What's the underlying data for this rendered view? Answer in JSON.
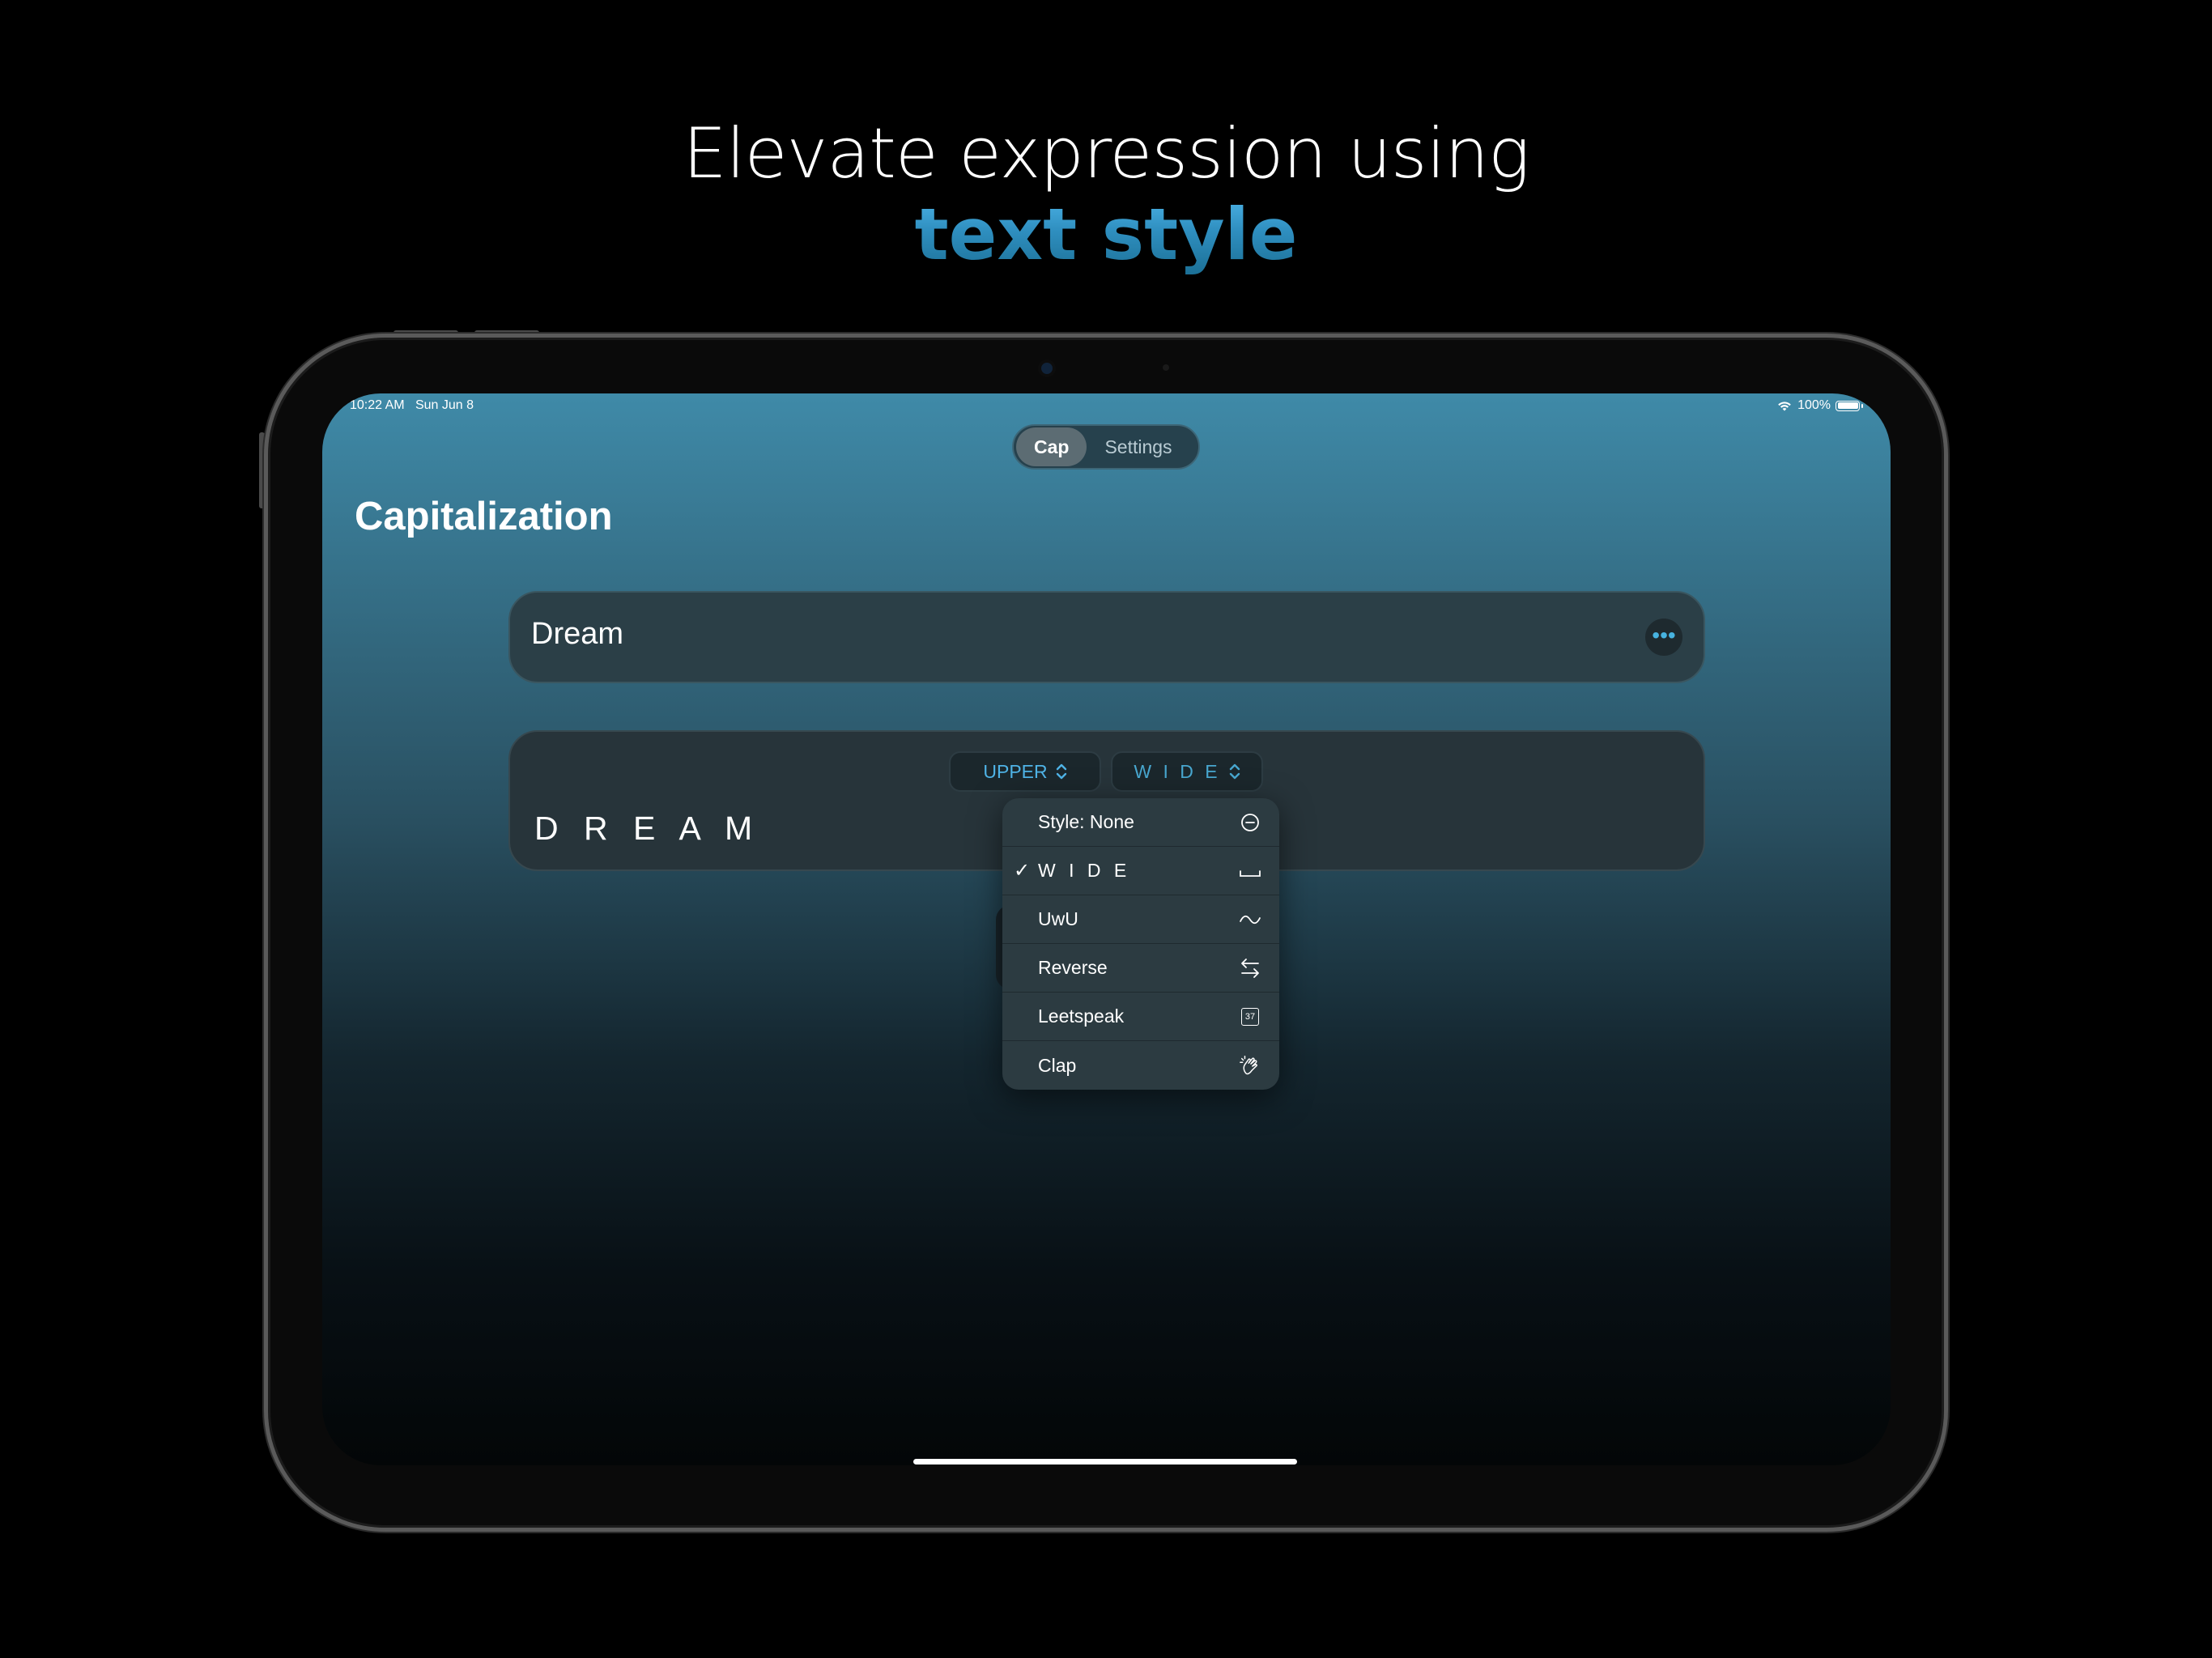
{
  "headline": {
    "line1": "Elevate expression using",
    "line2": "text style"
  },
  "status_bar": {
    "time_date": "10:22 AM   Sun Jun 8",
    "battery": "100%"
  },
  "tabs": [
    {
      "label": "Cap",
      "selected": true
    },
    {
      "label": "Settings",
      "selected": false
    }
  ],
  "page_title": "Capitalization",
  "input": {
    "value": "Dream"
  },
  "result": {
    "text": "D R E A M"
  },
  "capitalization_picker": {
    "value": "UPPER"
  },
  "style_picker": {
    "value": "W I D E"
  },
  "style_menu": {
    "items": [
      {
        "label": "Style: None",
        "icon": "minus-circle-icon",
        "checked": false
      },
      {
        "label": "W I D E",
        "icon": "space-icon",
        "checked": true
      },
      {
        "label": "UwU",
        "icon": "tilde-icon",
        "checked": false
      },
      {
        "label": "Reverse",
        "icon": "swap-arrows-icon",
        "checked": false
      },
      {
        "label": "Leetspeak",
        "icon": "number-37-icon",
        "checked": false
      },
      {
        "label": "Clap",
        "icon": "clap-hands-icon",
        "checked": false
      }
    ],
    "check_glyph": "✓",
    "leet_badge": "37"
  },
  "colors": {
    "accent": "#4fb3e6",
    "background_top": "#3f8aa8",
    "background_bottom": "#030607"
  }
}
